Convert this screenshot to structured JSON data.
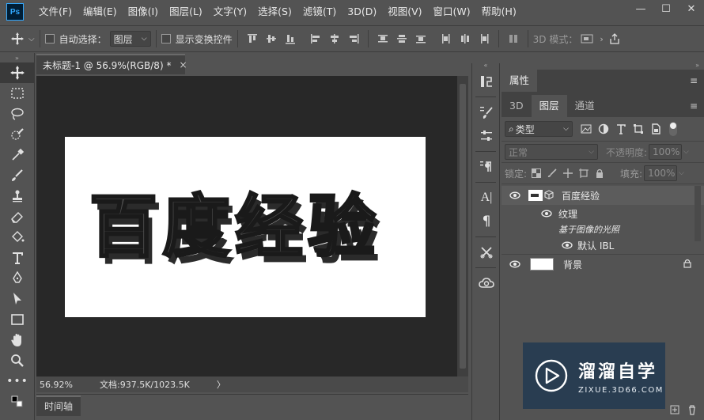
{
  "app": {
    "logo": "Ps"
  },
  "menu": [
    "文件(F)",
    "编辑(E)",
    "图像(I)",
    "图层(L)",
    "文字(Y)",
    "选择(S)",
    "滤镜(T)",
    "3D(D)",
    "视图(V)",
    "窗口(W)",
    "帮助(H)"
  ],
  "window_controls": {
    "minimize": "—",
    "restore": "☐",
    "close": "✕"
  },
  "options": {
    "auto_select_label": "自动选择：",
    "auto_select_value": "图层",
    "show_transform_label": "显示变换控件",
    "mode_3d_label": "3D 模式："
  },
  "document": {
    "tab_title": "未标题-1 @ 56.9%(RGB/8) *",
    "tab_close": "×",
    "canvas_text": "百度经验"
  },
  "status": {
    "zoom": "56.92%",
    "doc_info": "文档:937.5K/1023.5K",
    "arrow": "〉"
  },
  "timeline": {
    "label": "时间轴"
  },
  "panel": {
    "header": "属性",
    "tabs": [
      "3D",
      "图层",
      "通道"
    ],
    "active_tab": "图层",
    "filter_label": "类型",
    "blend_mode": "正常",
    "opacity_label": "不透明度:",
    "opacity_value": "100%",
    "lock_label": "锁定:",
    "fill_label": "填充:",
    "fill_value": "100%",
    "layers": [
      {
        "name": "百度经验",
        "type": "3d"
      },
      {
        "name": "纹理",
        "type": "sub"
      },
      {
        "name": "基于图像的光照",
        "type": "sub2"
      },
      {
        "name": "默认 IBL",
        "type": "sub3"
      },
      {
        "name": "背景",
        "type": "background"
      }
    ]
  },
  "watermark": {
    "title": "溜溜自学",
    "subtitle": "ZIXUE.3D66.COM"
  },
  "colors": {
    "bg": "#535353",
    "canvas_bg": "#282828",
    "accent": "#31a8ff",
    "watermark": "#203850"
  }
}
